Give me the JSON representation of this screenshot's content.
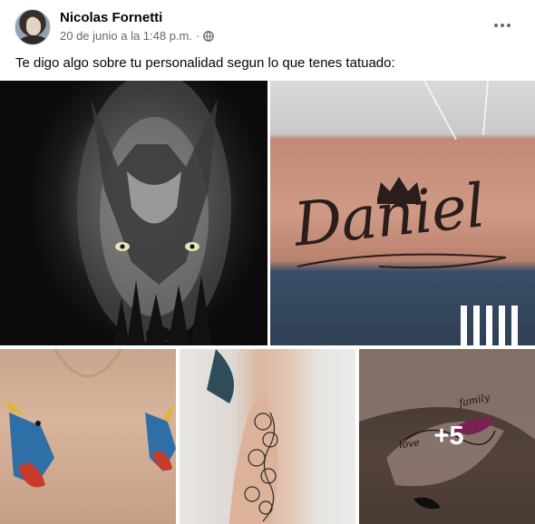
{
  "post": {
    "author": "Nicolas Fornetti",
    "date": "20 de junio a la 1:48 p.m.",
    "separator": "·",
    "text": "Te digo algo sobre tu personalidad segun lo que tenes tatuado:"
  },
  "icons": {
    "privacy": "globe-icon",
    "options": "more-horizontal-icon"
  },
  "gallery": {
    "photos": [
      {
        "subject": "wolf forest tattoo"
      },
      {
        "subject": "Daniel crown lettering tattoo",
        "tattoo_text": "Daniel"
      },
      {
        "subject": "swallow birds chest tattoo"
      },
      {
        "subject": "floral thigh tattoo"
      },
      {
        "subject": "infinity feather ankle tattoo",
        "tattoo_text_1": "family",
        "tattoo_text_2": "love"
      }
    ],
    "more_count": "+5"
  },
  "colors": {
    "name": "#050505",
    "meta": "#65676b",
    "overlay": "rgba(0,0,0,0.40)"
  }
}
